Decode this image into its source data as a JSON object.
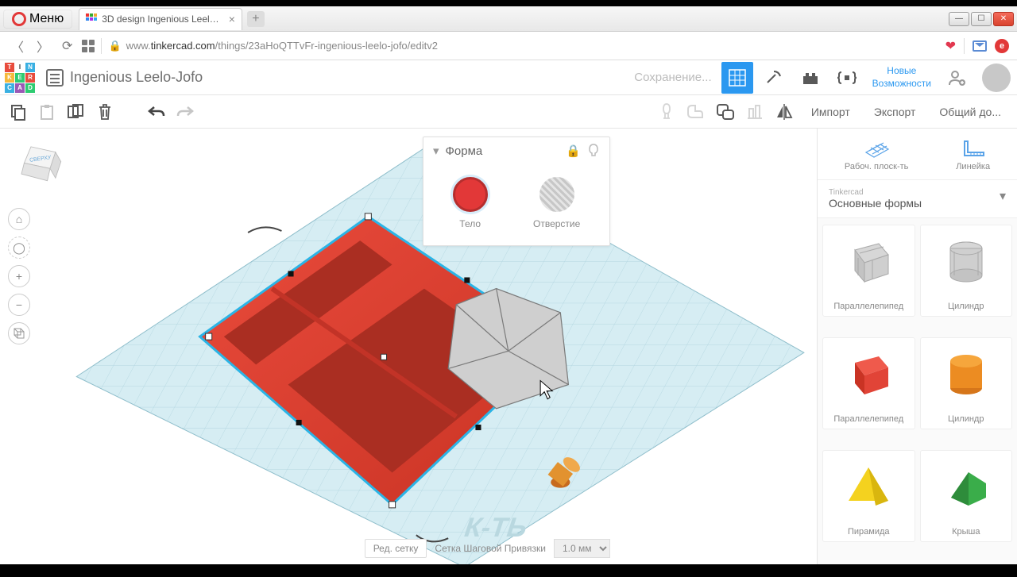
{
  "browser": {
    "menu": "Меню",
    "tab_title": "3D design Ingenious Leel…",
    "url_prefix": "www.",
    "url_host": "tinkercad.com",
    "url_path": "/things/23aHoQTTvFr-ingenious-leelo-jofo/editv2"
  },
  "header": {
    "project_name": "Ingenious Leelo-Jofo",
    "saving": "Сохранение...",
    "news1": "Новые",
    "news2": "Возможности"
  },
  "toolbar": {
    "import": "Импорт",
    "export": "Экспорт",
    "share": "Общий до..."
  },
  "inspector": {
    "title": "Форма",
    "solid": "Тело",
    "hole": "Отверстие"
  },
  "rpanel": {
    "workplane": "Рабоч. плоск-ть",
    "ruler": "Линейка",
    "cat_small": "Tinkercad",
    "cat_label": "Основные формы",
    "shapes": [
      "Параллелепипед",
      "Цилиндр",
      "Параллелепипед",
      "Цилиндр",
      "Пирамида",
      "Крыша"
    ]
  },
  "viewcube": "СВЕРХУ",
  "footer": {
    "edit_grid": "Ред. сетку",
    "snap_label": "Сетка Шаговой Привязки",
    "snap_value": "1.0 мм"
  }
}
